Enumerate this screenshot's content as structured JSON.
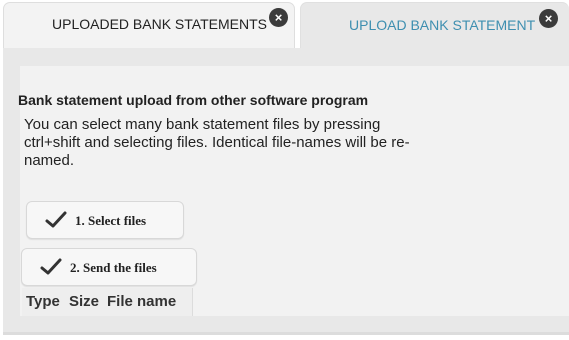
{
  "tabs": [
    {
      "label": "UPLOADED BANK STATEMENTS",
      "active": false
    },
    {
      "label": "UPLOAD BANK STATEMENT",
      "active": true
    }
  ],
  "close_icon": "×",
  "main": {
    "title": "Bank statement upload from other software program",
    "description": "You can select many bank statement files by pressing ctrl+shift and selecting files. Identical file-names will be re-named."
  },
  "buttons": {
    "select_files": "1. Select files",
    "send_files": "2. Send the files"
  },
  "table": {
    "columns": [
      "Type",
      "Size",
      "File name"
    ]
  },
  "colors": {
    "active_tab_text": "#3e8fb0",
    "panel_bg": "#e8e8e8"
  },
  "icons": {
    "close": "close-icon",
    "check": "checkmark-icon"
  }
}
